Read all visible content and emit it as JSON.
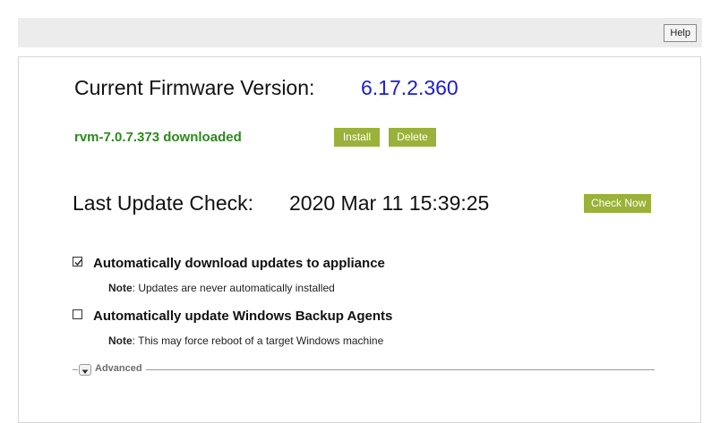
{
  "header": {
    "help_label": "Help"
  },
  "firmware": {
    "label": "Current Firmware Version:",
    "version": "6.17.2.360"
  },
  "download": {
    "status": "rvm-7.0.7.373 downloaded",
    "install_label": "Install",
    "delete_label": "Delete"
  },
  "update_check": {
    "label": "Last Update Check:",
    "value": "2020 Mar 11 15:39:25",
    "check_now_label": "Check Now"
  },
  "options": [
    {
      "label": "Automatically download updates to appliance",
      "checked": true,
      "note_prefix": "Note",
      "note_text": ": Updates are never automatically installed"
    },
    {
      "label": "Automatically update Windows Backup Agents",
      "checked": false,
      "note_prefix": "Note",
      "note_text": ": This may force reboot of a target Windows machine"
    }
  ],
  "advanced": {
    "label": "Advanced",
    "expanded": false
  },
  "colors": {
    "button_green": "#9ab13a",
    "status_green": "#2c8a1d",
    "version_blue": "#1b1bd6",
    "topbar_gray": "#ececec"
  },
  "icons": {
    "checkbox_checked": "check-mark-icon",
    "advanced_toggle": "chevron-down-icon"
  }
}
